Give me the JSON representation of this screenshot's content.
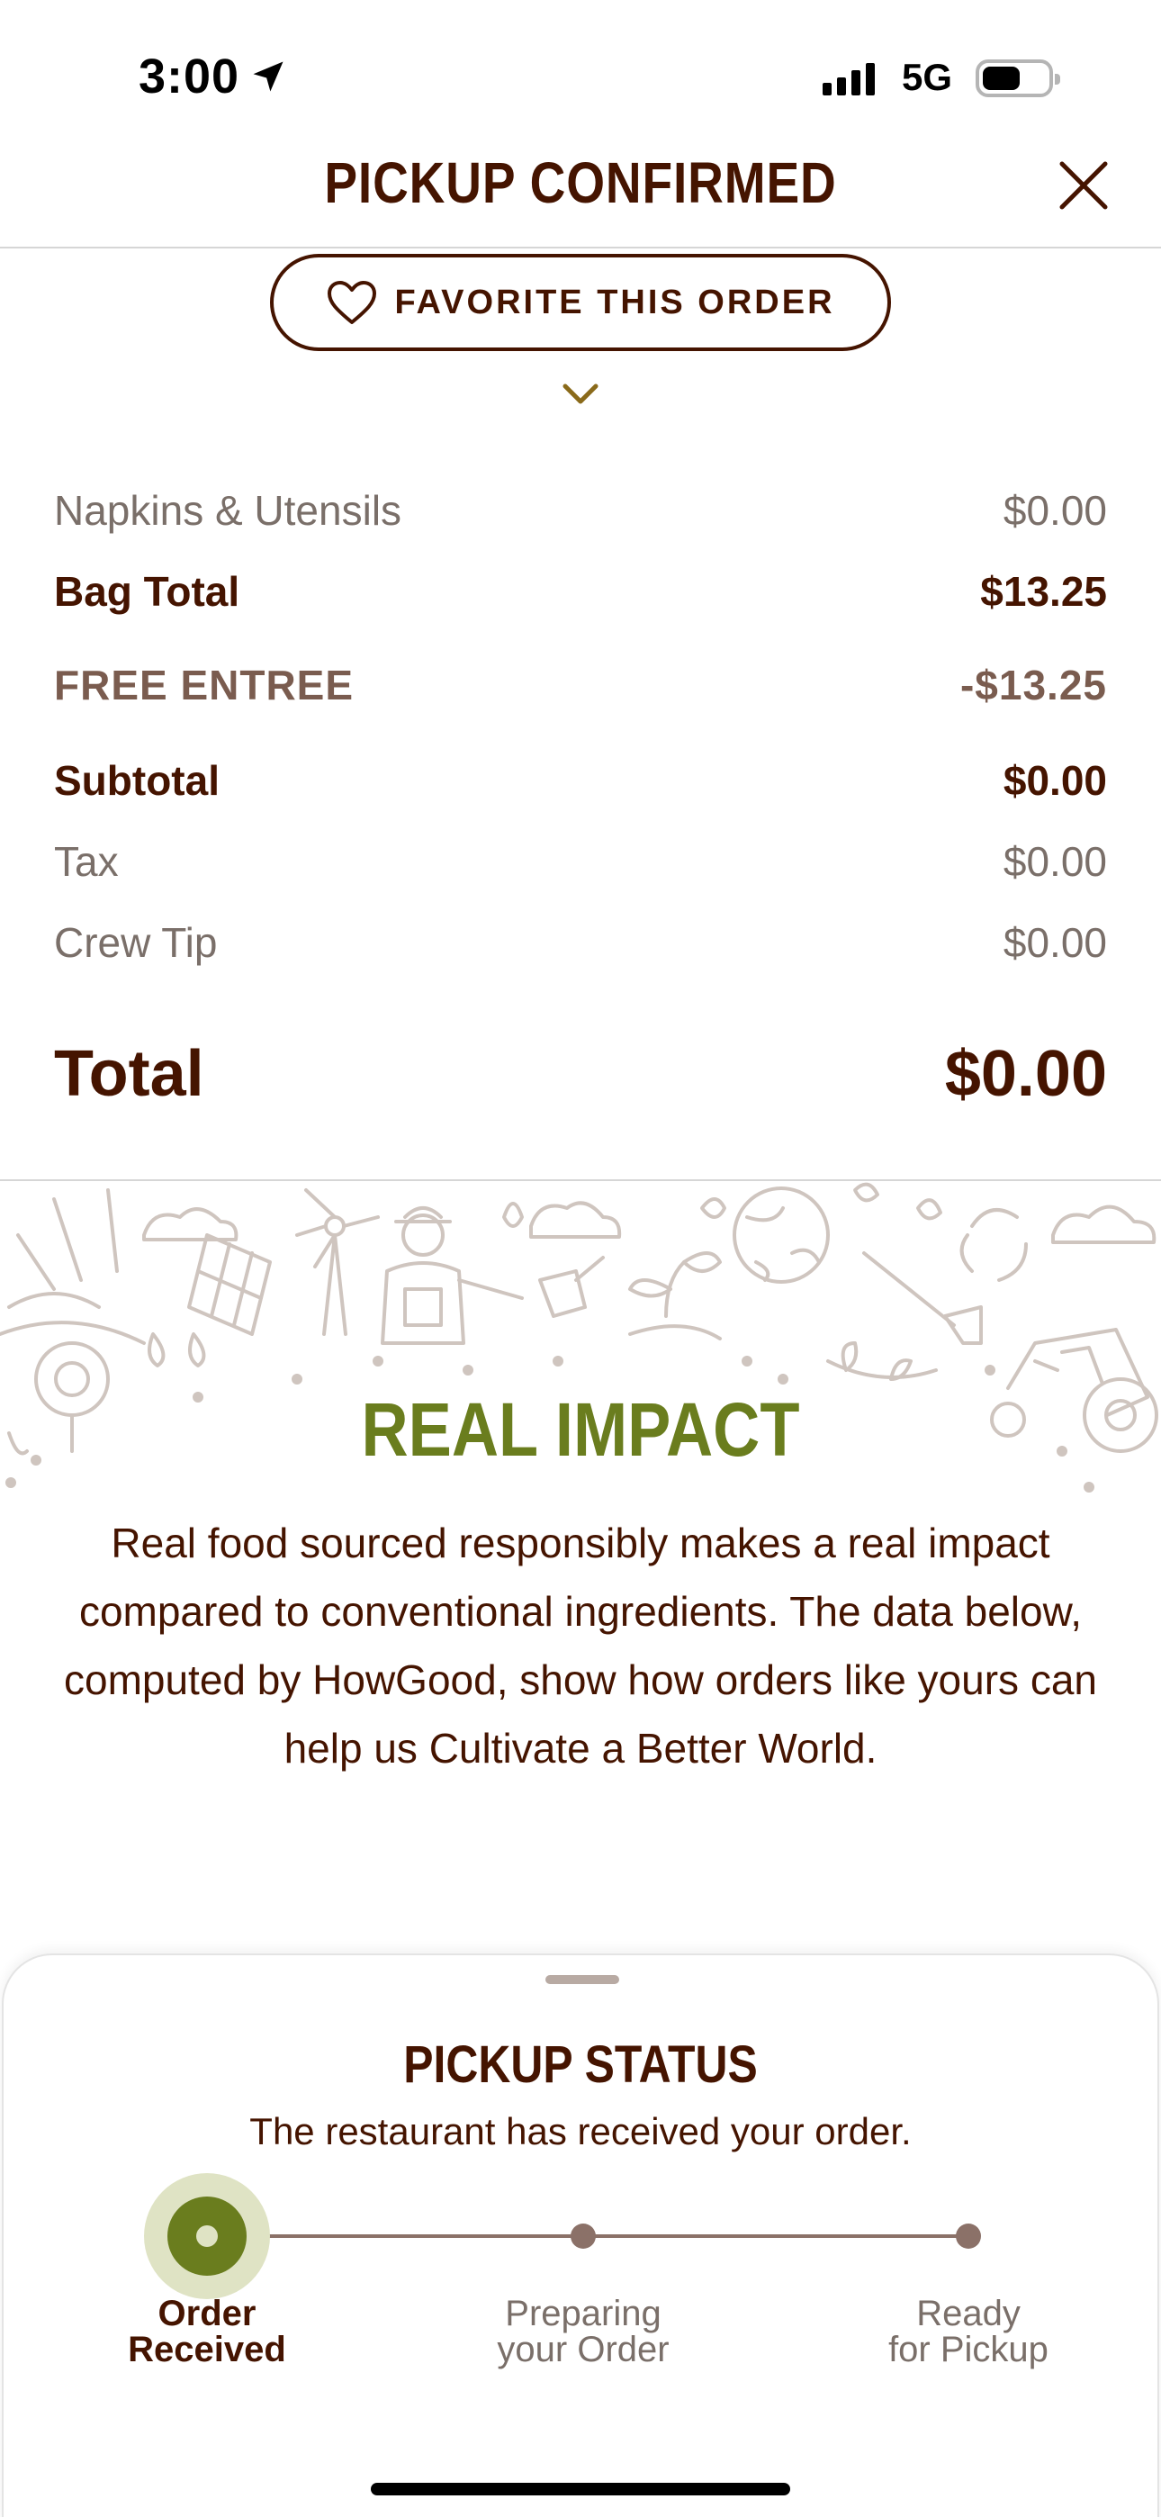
{
  "status_bar": {
    "time": "3:00",
    "network": "5G"
  },
  "header": {
    "title": "PICKUP CONFIRMED"
  },
  "favorite": {
    "label": "FAVORITE THIS ORDER"
  },
  "summary": {
    "napkins": {
      "label": "Napkins & Utensils",
      "amount": "$0.00"
    },
    "bag_total": {
      "label": "Bag Total",
      "amount": "$13.25"
    },
    "promo": {
      "label": "FREE ENTREE",
      "amount": "-$13.25"
    },
    "subtotal": {
      "label": "Subtotal",
      "amount": "$0.00"
    },
    "tax": {
      "label": "Tax",
      "amount": "$0.00"
    },
    "tip": {
      "label": "Crew Tip",
      "amount": "$0.00"
    },
    "total": {
      "label": "Total",
      "amount": "$0.00"
    }
  },
  "impact": {
    "title": "REAL IMPACT",
    "text": "Real food sourced responsibly makes a real impact compared to conventional ingredients. The data below, computed by HowGood, show how orders like yours can help us Cultivate a Better World."
  },
  "pickup_status": {
    "title": "PICKUP STATUS",
    "subtitle": "The restaurant has received your order.",
    "steps": [
      {
        "line1": "Order",
        "line2": "Received",
        "active": true
      },
      {
        "line1": "Preparing",
        "line2": "your Order",
        "active": false
      },
      {
        "line1": "Ready",
        "line2": "for Pickup",
        "active": false
      }
    ]
  },
  "colors": {
    "brown": "#451400",
    "green": "#6a7d1e",
    "muted": "#7a6f69",
    "illustration": "#cfc5bf"
  }
}
